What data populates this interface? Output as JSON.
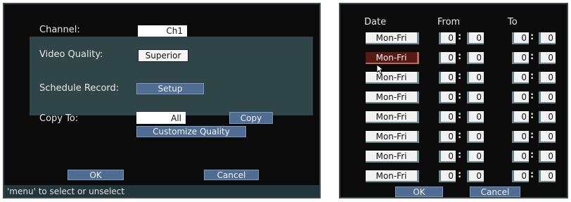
{
  "left": {
    "channel_label": "Channel:",
    "channel_value": "Ch1",
    "video_quality_label": "Video Quality:",
    "video_quality_value": "Superior",
    "schedule_label": "Schedule Record:",
    "setup_label": "Setup",
    "copy_to_label": "Copy To:",
    "copy_to_value": "All",
    "copy_label": "Copy",
    "customize_label": "Customize Quality",
    "ok_label": "OK",
    "cancel_label": "Cancel",
    "status_text": "'menu' to select or unselect"
  },
  "right": {
    "headers": {
      "date": "Date",
      "from": "From",
      "to": "To"
    },
    "rows": [
      {
        "day": "Mon-Fri",
        "from_h": "0",
        "from_m": "0",
        "to_h": "0",
        "to_m": "0"
      },
      {
        "day": "Mon-Fri",
        "from_h": "0",
        "from_m": "0",
        "to_h": "0",
        "to_m": "0"
      },
      {
        "day": "Mon-Fri",
        "from_h": "0",
        "from_m": "0",
        "to_h": "0",
        "to_m": "0"
      },
      {
        "day": "Mon-Fri",
        "from_h": "0",
        "from_m": "0",
        "to_h": "0",
        "to_m": "0"
      },
      {
        "day": "Mon-Fri",
        "from_h": "0",
        "from_m": "0",
        "to_h": "0",
        "to_m": "0"
      },
      {
        "day": "Mon-Fri",
        "from_h": "0",
        "from_m": "0",
        "to_h": "0",
        "to_m": "0"
      },
      {
        "day": "Mon-Fri",
        "from_h": "0",
        "from_m": "0",
        "to_h": "0",
        "to_m": "0"
      },
      {
        "day": "Mon-Fri",
        "from_h": "0",
        "from_m": "0",
        "to_h": "0",
        "to_m": "0"
      }
    ],
    "active_row": 1,
    "ok_label": "OK",
    "cancel_label": "Cancel"
  },
  "colors": {
    "panel_bg": "#0b0b0b",
    "panel_border": "#3a4a4c",
    "section_bg": "#2f4547",
    "button_blue": "#4f6c92",
    "active_day_bg": "#5a1a14"
  },
  "icons": {
    "pointer": "mouse-pointer-icon"
  }
}
